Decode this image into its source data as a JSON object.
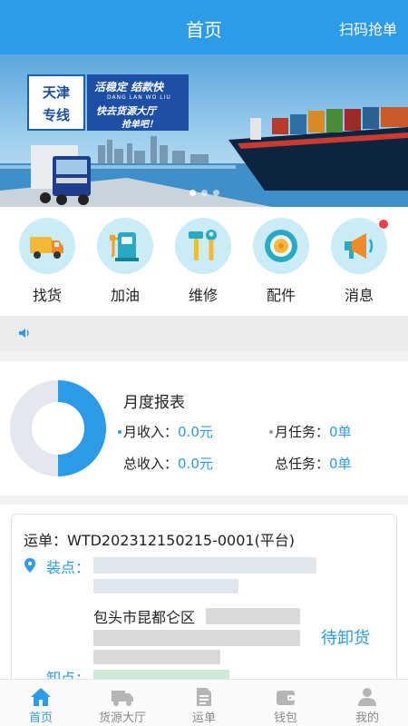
{
  "header": {
    "title": "首页",
    "scan_label": "扫码抢单"
  },
  "banner": {
    "logo_line1": "天津",
    "logo_line2": "专线",
    "slogan1": "活稳定 结款快",
    "slogan_en": "DANG LAN WO LIU",
    "slogan2": "快去货源大厅",
    "slogan3": "抢单吧！",
    "slide_count": 3,
    "active_slide": 1
  },
  "menu": {
    "items": [
      {
        "label": "找货",
        "icon": "truck-icon"
      },
      {
        "label": "加油",
        "icon": "fuel-pump-icon"
      },
      {
        "label": "维修",
        "icon": "repair-tools-icon"
      },
      {
        "label": "配件",
        "icon": "wheel-icon"
      },
      {
        "label": "消息",
        "icon": "megaphone-icon",
        "has_badge": true
      }
    ]
  },
  "notice": {
    "icon": "speaker-icon",
    "text": ""
  },
  "report": {
    "title": "月度报表",
    "month_income_label": "月收入：",
    "month_income_value": "0.0元",
    "month_task_label": "月任务：",
    "month_task_value": "0单",
    "total_income_label": "总收入：",
    "total_income_value": "0.0元",
    "total_task_label": "总任务：",
    "total_task_value": "0单"
  },
  "waybill": {
    "number": "运单：WTD202312150215-0001(平台)",
    "load_label": "装点：",
    "city": "包头市昆都仑区",
    "status": "待卸货",
    "unload_label": "卸点："
  },
  "tabbar": {
    "tabs": [
      {
        "label": "首页",
        "icon": "home-icon",
        "active": true
      },
      {
        "label": "货源大厅",
        "icon": "truck-icon",
        "active": false
      },
      {
        "label": "运单",
        "icon": "document-icon",
        "active": false
      },
      {
        "label": "钱包",
        "icon": "wallet-icon",
        "active": false
      },
      {
        "label": "我的",
        "icon": "user-icon",
        "active": false
      }
    ]
  },
  "colors": {
    "primary": "#2e9be8",
    "ring_track": "#e3e7ee",
    "badge": "#ee3d4b",
    "icon_bg": "#c9ecf6"
  }
}
